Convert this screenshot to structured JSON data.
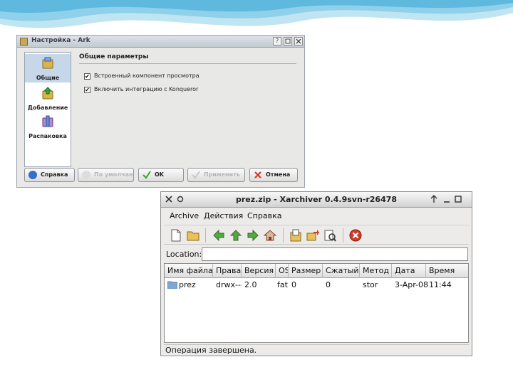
{
  "ark": {
    "title": "Настройка - Ark",
    "help_symbol": "?",
    "sidebar": [
      {
        "label": "Общие",
        "icon": "general-settings-icon",
        "selected": true
      },
      {
        "label": "Добавление",
        "icon": "add-archive-icon",
        "selected": false
      },
      {
        "label": "Распаковка",
        "icon": "extract-archive-icon",
        "selected": false
      }
    ],
    "section_title": "Общие параметры",
    "options": [
      {
        "label": "Встроенный компонент просмотра",
        "checked": true
      },
      {
        "label": "Включить интеграцию с Konqueror",
        "checked": true
      }
    ],
    "check_mark": "✔",
    "buttons": {
      "help": "Справка",
      "defaults": "По умолчанию",
      "ok": "OK",
      "apply": "Применить",
      "cancel": "Отмена"
    }
  },
  "xarchiver": {
    "title": "prez.zip - Xarchiver 0.4.9svn-r26478",
    "menu": [
      "Archive",
      "Действия",
      "Справка"
    ],
    "location_label": "Location:",
    "location_value": "",
    "columns": [
      "Имя файла",
      "Права",
      "Версия",
      "OS",
      "Размер",
      "Сжатый",
      "Метод",
      "Дата",
      "Время"
    ],
    "rows": [
      [
        "prez",
        "drwx---",
        "2.0",
        "fat",
        "0",
        "0",
        "stor",
        "3-Apr-08",
        "11:44"
      ]
    ],
    "status": "Операция завершена."
  },
  "colors": {
    "selection": "#c6d7ea",
    "ok_green": "#3aa53a",
    "cancel_red": "#d23b2a",
    "help_blue": "#3470c8"
  }
}
